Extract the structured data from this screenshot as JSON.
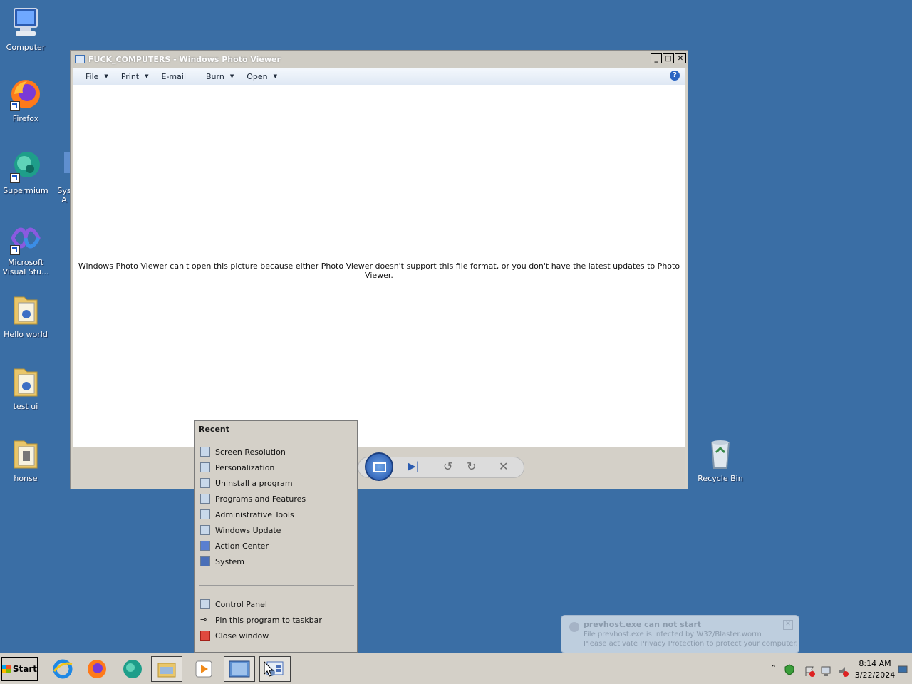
{
  "desktop": {
    "icons": [
      {
        "label": "Computer"
      },
      {
        "label": "Firefox"
      },
      {
        "label": "Supermium"
      },
      {
        "label": "Microsoft Visual Stu..."
      },
      {
        "label": "Hello world"
      },
      {
        "label": "test ui"
      },
      {
        "label": "honse"
      },
      {
        "label": "Recycle Bin"
      },
      {
        "label": "Sys A"
      }
    ]
  },
  "window": {
    "title": "FUCK_COMPUTERS - Windows Photo Viewer",
    "menu": [
      "File",
      "Print",
      "E-mail",
      "Burn",
      "Open"
    ],
    "message": "Windows Photo Viewer can't open this picture because either Photo Viewer doesn't support this file format, or you don't have the latest updates to Photo Viewer."
  },
  "jumplist": {
    "header": "Recent",
    "recent": [
      "Screen Resolution",
      "Personalization",
      "Uninstall a program",
      "Programs and Features",
      "Administrative Tools",
      "Windows Update",
      "Action Center",
      "System"
    ],
    "tasks": [
      "Control Panel",
      "Pin this program to taskbar",
      "Close window"
    ]
  },
  "notification": {
    "title": "prevhost.exe can not start",
    "line1": "File prevhost.exe is infected by W32/Blaster.worm",
    "line2": "Please activate Privacy Protection to protect your computer."
  },
  "taskbar": {
    "start_label": "Start",
    "time": "8:14 AM",
    "date": "3/22/2024"
  }
}
